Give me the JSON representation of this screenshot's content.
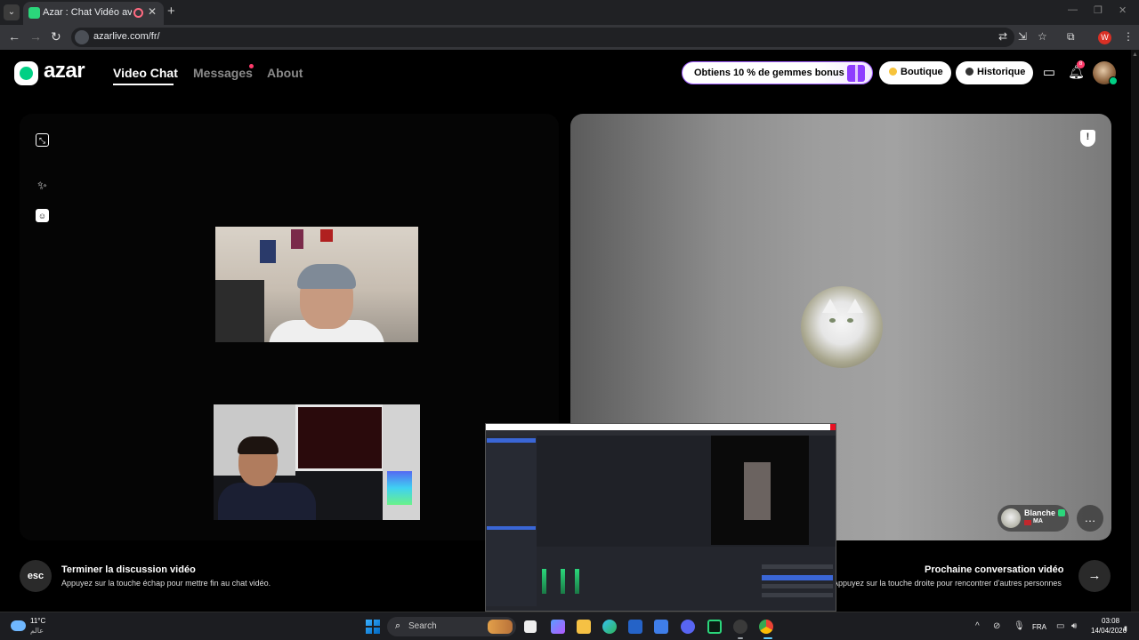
{
  "browser": {
    "tab_title": "Azar : Chat Vidéo avec de n",
    "url": "azarlive.com/fr/",
    "profile_initial": "W",
    "new_tab": "+",
    "tab_close": "✕",
    "back": "←",
    "forward": "→",
    "reload": "↻"
  },
  "app": {
    "logo_text": "azar",
    "nav": {
      "video_chat": "Video Chat",
      "messages": "Messages",
      "about": "About"
    },
    "promo_label": "Obtiens 10 % de gemmes bonus !",
    "boutique_label": "Boutique",
    "historique_label": "Historique",
    "notification_count": "8"
  },
  "partner": {
    "name": "Blanche",
    "country": "MA"
  },
  "actions": {
    "esc_key": "esc",
    "end_title": "Terminer la discussion vidéo",
    "end_desc": "Appuyez sur la touche échap pour mettre fin au chat vidéo.",
    "next_title": "Prochaine conversation vidéo",
    "next_desc": "Appuyez sur la touche droite pour rencontrer d'autres personnes"
  },
  "taskbar": {
    "weather_temp": "11°C",
    "weather_desc": "عالم",
    "search_placeholder": "Search",
    "language": "FRA",
    "time": "03:08",
    "date": "14/04/2026"
  },
  "colors": {
    "brand_green": "#00d084",
    "promo_purple": "#8e3dff",
    "alert_red": "#ff3b6b"
  }
}
